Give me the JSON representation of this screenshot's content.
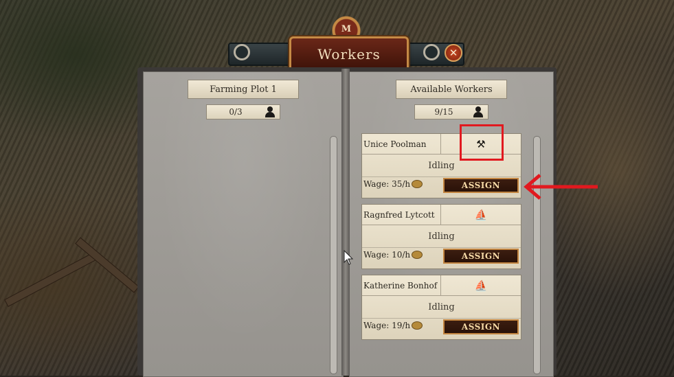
{
  "window": {
    "title": "Workers",
    "crest_text": "M",
    "close_glyph": "✕"
  },
  "left_page": {
    "header": "Farming Plot 1",
    "count": "0/3",
    "count_icon": "person-icon"
  },
  "right_page": {
    "header": "Available Workers",
    "count": "9/15",
    "count_icon": "person-icon"
  },
  "workers": [
    {
      "name": "Unice Poolman",
      "job_icon": "shovel-icon",
      "job_glyph": "⚒",
      "status": "Idling",
      "wage": "Wage: 35/h",
      "assign_label": "ASSIGN"
    },
    {
      "name": "Ragnfred Lytcott",
      "job_icon": "sailboat-icon",
      "job_glyph": "⛵",
      "status": "Idling",
      "wage": "Wage: 10/h",
      "assign_label": "ASSIGN"
    },
    {
      "name": "Katherine Bonhof",
      "job_icon": "sailboat-icon",
      "job_glyph": "⛵",
      "status": "Idling",
      "wage": "Wage: 19/h",
      "assign_label": "ASSIGN"
    }
  ],
  "colors": {
    "annotation": "#e1191f",
    "button_border": "#c2843f",
    "title_plate": "#6a2718"
  }
}
